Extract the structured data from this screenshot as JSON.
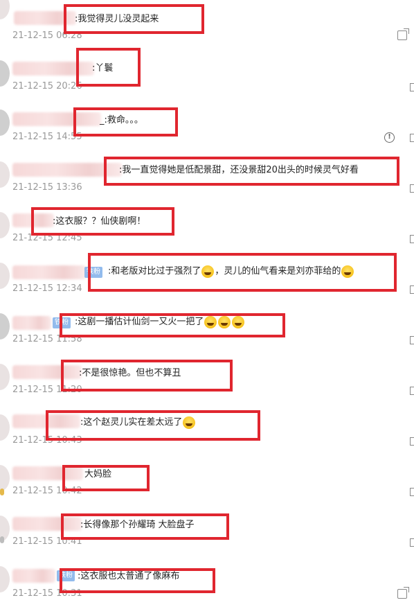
{
  "comments": [
    {
      "text": ":我觉得灵儿没灵起来",
      "date": "21-12-15 06:28"
    },
    {
      "text": ":丫鬟",
      "date": "21-12-15 20:26"
    },
    {
      "text": "_:救命。。。",
      "date": "21-12-15 14:55"
    },
    {
      "text": ":我一直觉得她是低配景甜，还没景甜20出头的时候灵气好看",
      "date": "21-12-15 13:36"
    },
    {
      "text": ":这衣服？？仙侠剧啊！",
      "date": "21-12-15 12:45"
    },
    {
      "badge": "铁粉",
      "text": ":和老版对比过于强烈了",
      "text2": "，灵儿的仙气看来是刘亦菲给的",
      "date": "21-12-15 12:34"
    },
    {
      "badge": "铁粉",
      "text": ":这剧一播估计仙剑一又火一把了",
      "date": "21-12-15 11:58"
    },
    {
      "text": ":不是很惊艳。但也不算丑",
      "date": "21-12-15 11:20"
    },
    {
      "text": ":这个赵灵儿实在差太远了",
      "date": "21-12-15 10:43"
    },
    {
      "text": "大妈脸",
      "date": "21-12-15 10:42"
    },
    {
      "text": ":长得像那个孙耀琦 大脸盘子",
      "date": "21-12-15 10:41"
    },
    {
      "badge": "铁粉",
      "text": ":这衣服也太普通了像麻布",
      "date": "21-12-15 10:31"
    }
  ],
  "icons": {
    "share": "share-icon",
    "report": "report-icon",
    "emoji": "laugh-cry-emoji-icon"
  },
  "colors": {
    "highlight_box": "#e0262f",
    "badge": "#7fb0ea",
    "date_text": "#999999"
  }
}
